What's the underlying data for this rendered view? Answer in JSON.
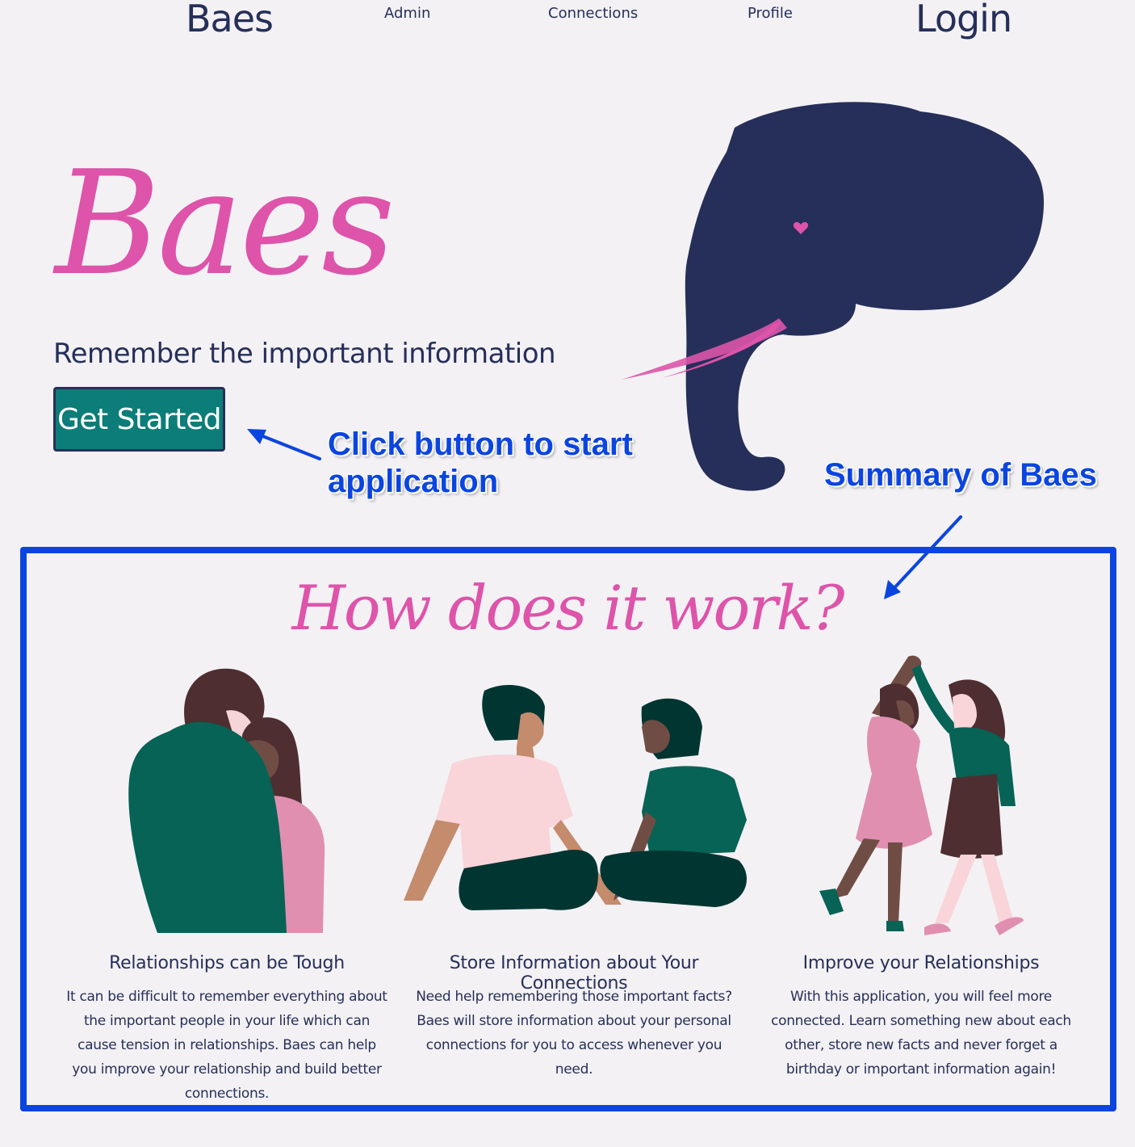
{
  "nav": {
    "logo": "Baes",
    "links": [
      "Admin",
      "Connections",
      "Profile"
    ],
    "login": "Login"
  },
  "hero": {
    "title": "Baes",
    "subtitle": "Remember the important information",
    "cta": "Get Started",
    "mascot": "elephant-heart-illustration"
  },
  "annotations": {
    "button_note": "Click button to start\napplication",
    "summary_note": "Summary of Baes"
  },
  "summary": {
    "title": "How does it work?",
    "cards": [
      {
        "illustration": "hugging-couple-illustration",
        "heading": "Relationships can be Tough",
        "text": "It can be difficult to remember everything about the important people in your life which can cause tension in relationships. Baes can help you improve your relationship and build better connections."
      },
      {
        "illustration": "sitting-couple-illustration",
        "heading": "Store Information about Your Connections",
        "text": "Need help remembering those important facts? Baes will store information about your personal connections for you to access whenever you need."
      },
      {
        "illustration": "dancing-couple-illustration",
        "heading": "Improve your Relationships",
        "text": "With this application, you will feel more connected. Learn something new about each other, store new facts and never forget a birthday or important information again!"
      }
    ]
  },
  "colors": {
    "navy": "#262f59",
    "pink": "#dd54aa",
    "teal": "#0c7d78",
    "annotation_blue": "#0b45e0",
    "background": "#f3f1f4"
  }
}
